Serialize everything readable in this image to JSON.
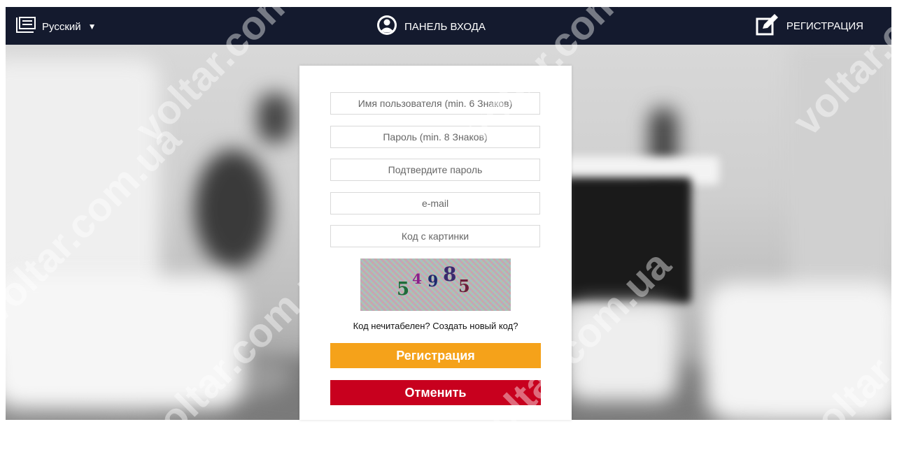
{
  "header": {
    "language": "Русский",
    "login_label": "ПАНЕЛЬ ВХОДА",
    "register_label": "РЕГИСТРАЦИЯ"
  },
  "form": {
    "username_placeholder": "Имя пользователя (min. 6 Знаков)",
    "password_placeholder": "Пароль (min. 8 Знаков)",
    "confirm_placeholder": "Подтвердите пароль",
    "email_placeholder": "e-mail",
    "captcha_placeholder": "Код с картинки",
    "captcha_code": "54985",
    "captcha_refresh_link": "Код нечитабелен? Создать новый код?",
    "register_button": "Регистрация",
    "cancel_button": "Отменить"
  },
  "watermark": "voltar.com.ua",
  "colors": {
    "header_bg": "#141a2e",
    "register_button": "#f5a21a",
    "cancel_button": "#c8001e"
  }
}
